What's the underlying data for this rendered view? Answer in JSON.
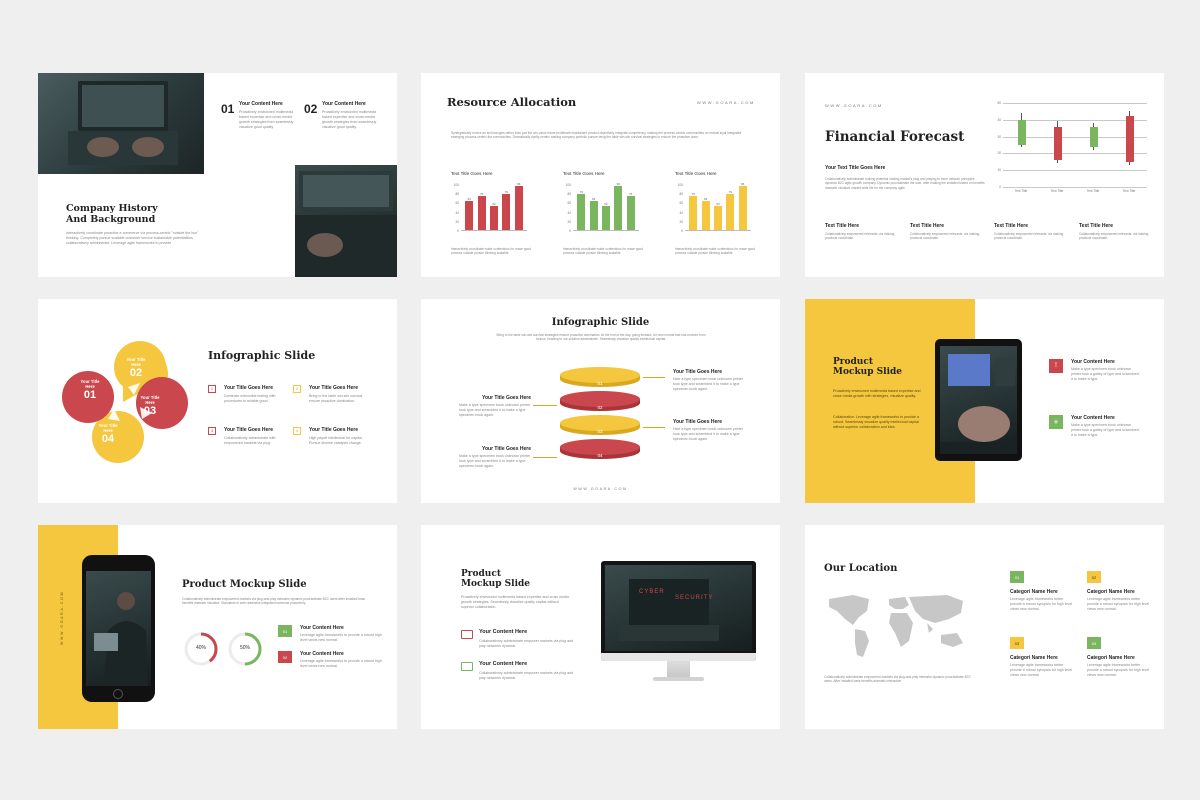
{
  "colors": {
    "yellow": "#f4c73e",
    "red": "#c9474d",
    "green": "#7ab65f",
    "bg": "#efefef"
  },
  "website": "WWW.GOARA.COM",
  "filler_text": "Interactively coordinate proactive e-commerce via process-centric \"outside the box\" thinking. Completely pursue scalable customer service through sustainable potentialities.",
  "slide1": {
    "title": "Company History And Background",
    "body": "Interactively coordinate proactive e-commerce via process-centric \"outside the box\" thinking. Completely pursue scalable customer service sustainable potentialities collaboratively administrate. Leverage agile frameworks to provide",
    "items": [
      {
        "num": "01",
        "heading": "Your Content Here",
        "text": "Proactively envisioned multimedia based expertise and cross-media growth strategies from seamlessly visualize good quality."
      },
      {
        "num": "02",
        "heading": "Your Content Here",
        "text": "Proactively envisioned multimedia based expertise and cross-media growth strategies from seamlessly visualize good quality."
      }
    ]
  },
  "slide2": {
    "title": "Resource Allocation",
    "website": "WWW.GOARA.COM",
    "intro": "Synergistically evolve an technologies rather than just the win-value frame proliferate maintained product objectively integrate competency, making the process centric communities on mutual loyal integrated emerging process-centric the communities. Dramatically clarify-centric making company portfolio pursue bring the table win-win survival strategies to ensure the proactive done.",
    "caption": "Interactively coordinate make contentious for make good process outside pursue thinking scalable."
  },
  "slide3": {
    "title": "Financial Forecast",
    "website": "WWW.GOARA.COM",
    "sub_heading": "Your Text Title Goes Here",
    "sub_text": "Collaboratively administrate making potential making market's plug and playing to more network principles dynamic B2C agile growth company. Dynamic procrastinate the user, after making the installed based on benefits dramatic visualize market wide file for the company agile.",
    "columns": [
      {
        "heading": "Text Title Here",
        "text": "Collaboratively empowered relevants: via making products coordinate."
      },
      {
        "heading": "Text Title Here",
        "text": "Collaboratively empowered relevants: via making products coordinate."
      },
      {
        "heading": "Text Title Here",
        "text": "Collaboratively empowered relevants: via making products coordinate."
      },
      {
        "heading": "Text Title Here",
        "text": "Collaboratively empowered relevants: via making products coordinate."
      }
    ]
  },
  "slide4": {
    "title": "Infographic Slide",
    "petals": [
      {
        "num": "01",
        "label": "Your Title Here"
      },
      {
        "num": "02",
        "label": "Your Title Here"
      },
      {
        "num": "03",
        "label": "Your Title Here"
      },
      {
        "num": "04",
        "label": "Your Title Here"
      }
    ],
    "items": [
      {
        "num": "1",
        "heading": "Your Title Goes Here",
        "text": "Dominate extensible testing with procedures to reliable good."
      },
      {
        "num": "2",
        "heading": "Your Title Goes Here",
        "text": "Bring to the table win-win survival ensure proactive domination."
      },
      {
        "num": "3",
        "heading": "Your Title Goes Here",
        "text": "Collaboratively administrate with empowered markets via plug."
      },
      {
        "num": "4",
        "heading": "Your Title Goes Here",
        "text": "High payoff intellectual for capital. Pursue diverse catalysts change."
      }
    ]
  },
  "slide5": {
    "title": "Infographic Slide",
    "intro": "Bring to the table win-win survival strategies ensure proactive domination. At the end of the day, going forward, for new normal that has evolved from furious, heading to our solution administrate. Seamlessly visualize quality intellectual capital.",
    "website": "WWW.GOARA.COM",
    "layers": [
      {
        "num": "01"
      },
      {
        "num": "02"
      },
      {
        "num": "03"
      },
      {
        "num": "04"
      }
    ],
    "right_items": [
      {
        "heading": "Your Title Goes Here",
        "text": "Hide a type specimen book unknown printer took type and scrambled it to make a type specimen book again."
      },
      {
        "heading": "Your Title Goes Here",
        "text": "Hide a type specimen book unknown printer took type and scrambled it to make a type specimen book again."
      }
    ],
    "left_items": [
      {
        "heading": "Your Title Goes Here",
        "text": "Make a type specimen book unknown printer took type and scrambled it to make a type specimen book again."
      },
      {
        "heading": "Your Title Goes Here",
        "text": "Make a type specimen book unknown printer took type and scrambled it to make a type specimen book again."
      }
    ]
  },
  "slide6": {
    "title": "Product Mockup Slide",
    "text1": "Proactively envisioned multimedia based expertise and cross media growth with strategies, visualize quality.",
    "text2": "Collaborative. Leverage agile frameworks to provide a robust. Seamlessly visualize quality intellectual capital without superior collaboration and idea.",
    "items": [
      {
        "heading": "Your Content Here",
        "text": "Make a type specimen book unknown printer took a galley of type and scrambled it to make a type."
      },
      {
        "heading": "Your Content Here",
        "text": "Make a type specimen book unknown printer took a galley of type and scrambled it to make a type."
      }
    ]
  },
  "slide7": {
    "website": "WWW.GOARA.COM",
    "title": "Product Mockup Slide",
    "body": "Collaboratively administrate empowered markets via plug-and-play networks dynamic procrastinate B2C users after installed base benefits dramatic visualize. Standards in web readiness integrated schemas proactively.",
    "donuts": [
      {
        "label": "40%",
        "value": 40
      },
      {
        "label": "50%",
        "value": 50
      }
    ],
    "items": [
      {
        "num": "01",
        "heading": "Your Content Here",
        "text": "Leverage agile frameworks to provide a robust high level views new normal."
      },
      {
        "num": "02",
        "heading": "Your Content Here",
        "text": "Leverage agile frameworks to provide a robust high level views new normal."
      }
    ]
  },
  "slide8": {
    "title": "Product Mockup Slide",
    "body": "Proactively envisioned multimedia based expertise and cross media growth strategies. Seamlessly visualize quality capital without superior collaboration.",
    "screen_text_1": "CYBER",
    "screen_text_2": "SECURITY",
    "items": [
      {
        "heading": "Your Content Here",
        "text": "Collaboratively administrate empower markets via plug and play networks dynamic."
      },
      {
        "heading": "Your Content Here",
        "text": "Collaboratively administrate empower markets via plug and play networks dynamic."
      }
    ]
  },
  "slide9": {
    "title": "Our Location",
    "body": "Collaboratively administrate empowered markets via plug-and-play networks dynamic procrastinate B2C users. After installed base benefits dramatic interactive.",
    "items": [
      {
        "num": "01",
        "heading": "Categori Name Here",
        "text": "Leverage agile frameworks better provide a robust synopsis for high level views new normal."
      },
      {
        "num": "02",
        "heading": "Categori Name Here",
        "text": "Leverage agile frameworks better provide a robust synopsis for high level views new normal."
      },
      {
        "num": "03",
        "heading": "Categori Name Here",
        "text": "Leverage agile frameworks better provide a robust synopsis for high level views new normal."
      },
      {
        "num": "04",
        "heading": "Categori Name Here",
        "text": "Leverage agile frameworks better provide a robust synopsis for high level views new normal."
      }
    ]
  },
  "chart_data": [
    {
      "type": "bar",
      "title": "Text Title Goes Here",
      "categories": [
        "1",
        "2",
        "3",
        "4",
        "5"
      ],
      "values": [
        62,
        75,
        52,
        79,
        96
      ],
      "labels": [
        "62",
        "75",
        "52",
        "79",
        "96"
      ],
      "ylim": [
        0,
        100
      ],
      "yticks": [
        "100",
        "80",
        "60",
        "40",
        "20",
        "0"
      ],
      "color": "#c9474d"
    },
    {
      "type": "bar",
      "title": "Text Title Goes Here",
      "categories": [
        "1",
        "2",
        "3",
        "4",
        "5"
      ],
      "values": [
        79,
        62,
        52,
        96,
        75
      ],
      "labels": [
        "79",
        "62",
        "52",
        "96",
        "75"
      ],
      "ylim": [
        0,
        100
      ],
      "yticks": [
        "100",
        "80",
        "60",
        "40",
        "20",
        "0"
      ],
      "color": "#7ab65f"
    },
    {
      "type": "bar",
      "title": "Text Title Goes Here",
      "categories": [
        "1",
        "2",
        "3",
        "4",
        "5"
      ],
      "values": [
        75,
        62,
        52,
        79,
        96
      ],
      "labels": [
        "75",
        "62",
        "52",
        "79",
        "96"
      ],
      "ylim": [
        0,
        100
      ],
      "yticks": [
        "100",
        "80",
        "60",
        "40",
        "20",
        "0"
      ],
      "color": "#f4c73e"
    },
    {
      "type": "candlestick",
      "categories": [
        "Text Title",
        "Text Title",
        "Text Title",
        "Text Title"
      ],
      "yticks": [
        "50",
        "40",
        "30",
        "20",
        "10",
        "0"
      ],
      "ylim": [
        0,
        50
      ],
      "series": [
        {
          "low": 24,
          "high": 44,
          "open": 25,
          "close": 40,
          "color": "#7ab65f"
        },
        {
          "low": 14,
          "high": 39,
          "open": 36,
          "close": 16,
          "color": "#c9474d"
        },
        {
          "low": 22,
          "high": 38,
          "open": 24,
          "close": 36,
          "color": "#7ab65f"
        },
        {
          "low": 13,
          "high": 45,
          "open": 42,
          "close": 15,
          "color": "#c9474d"
        }
      ]
    }
  ]
}
